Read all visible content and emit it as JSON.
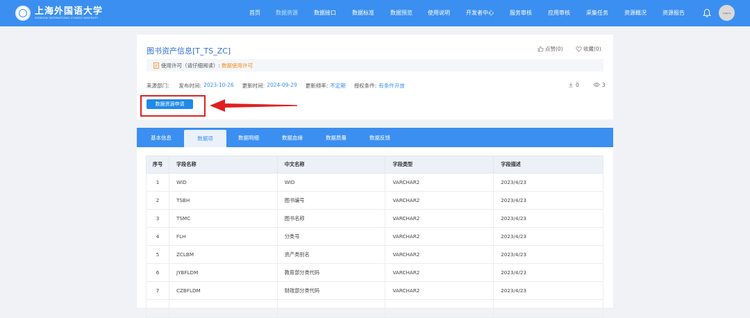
{
  "header": {
    "logo_cn": "上海外国语大学",
    "logo_en": "SHANGHAI INTERNATIONAL STUDIES UNIVERSITY",
    "nav": [
      {
        "label": "首页",
        "active": false
      },
      {
        "label": "数据资源",
        "active": true
      },
      {
        "label": "数据接口",
        "active": false
      },
      {
        "label": "数据标准",
        "active": false
      },
      {
        "label": "数据预览",
        "active": false
      },
      {
        "label": "使用说明",
        "active": false
      },
      {
        "label": "开发者中心",
        "active": false
      },
      {
        "label": "服务审核",
        "active": false
      },
      {
        "label": "应用审核",
        "active": false
      },
      {
        "label": "采集任务",
        "active": false
      },
      {
        "label": "资源概况",
        "active": false
      },
      {
        "label": "资源报告",
        "active": false
      }
    ],
    "avatar_text": "Jingjing"
  },
  "dataset": {
    "title": "图书资产信息[T_TS_ZC]",
    "like_label": "点赞(0)",
    "fav_label": "收藏(0)",
    "license_label": "使用许可（请仔细阅读）:",
    "license_link": "数据使用许可",
    "source_dept_label": "来源部门:",
    "source_dept": "",
    "publish_label": "发布时间:",
    "publish_time": "2023-10-26",
    "update_label": "更新时间:",
    "update_time": "2024-09-29",
    "freq_label": "更新频率:",
    "freq": "不定期",
    "auth_label": "授权条件:",
    "auth": "有条件开放",
    "downloads": "0",
    "views": "3",
    "apply_button": "数据资源申请"
  },
  "tabs": [
    {
      "label": "基本信息",
      "active": false
    },
    {
      "label": "数据项",
      "active": true
    },
    {
      "label": "数据明细",
      "active": false
    },
    {
      "label": "数据血缘",
      "active": false
    },
    {
      "label": "数据质量",
      "active": false
    },
    {
      "label": "数据反馈",
      "active": false
    }
  ],
  "table": {
    "columns": [
      "序号",
      "字段名称",
      "中文名称",
      "字段类型",
      "字段描述"
    ],
    "rows": [
      [
        "1",
        "WID",
        "WID",
        "VARCHAR2",
        "2023/4/23"
      ],
      [
        "2",
        "TSBH",
        "图书编号",
        "VARCHAR2",
        "2023/4/23"
      ],
      [
        "3",
        "TSMC",
        "图书名称",
        "VARCHAR2",
        "2023/4/23"
      ],
      [
        "4",
        "FLH",
        "分类号",
        "VARCHAR2",
        "2023/4/23"
      ],
      [
        "5",
        "ZCLBM",
        "资产类别名",
        "VARCHAR2",
        "2023/4/23"
      ],
      [
        "6",
        "JYBFLDM",
        "教育部分类代码",
        "VARCHAR2",
        "2023/4/23"
      ],
      [
        "7",
        "CZBFLDM",
        "财政部分类代码",
        "VARCHAR2",
        "2023/4/23"
      ],
      [
        "",
        "",
        "",
        "",
        ""
      ]
    ]
  },
  "colors": {
    "header_bg": "#3b8ff0",
    "title_blue": "#2f6fd6",
    "license_orange": "#f08c1c",
    "highlight_red": "#e02020"
  }
}
